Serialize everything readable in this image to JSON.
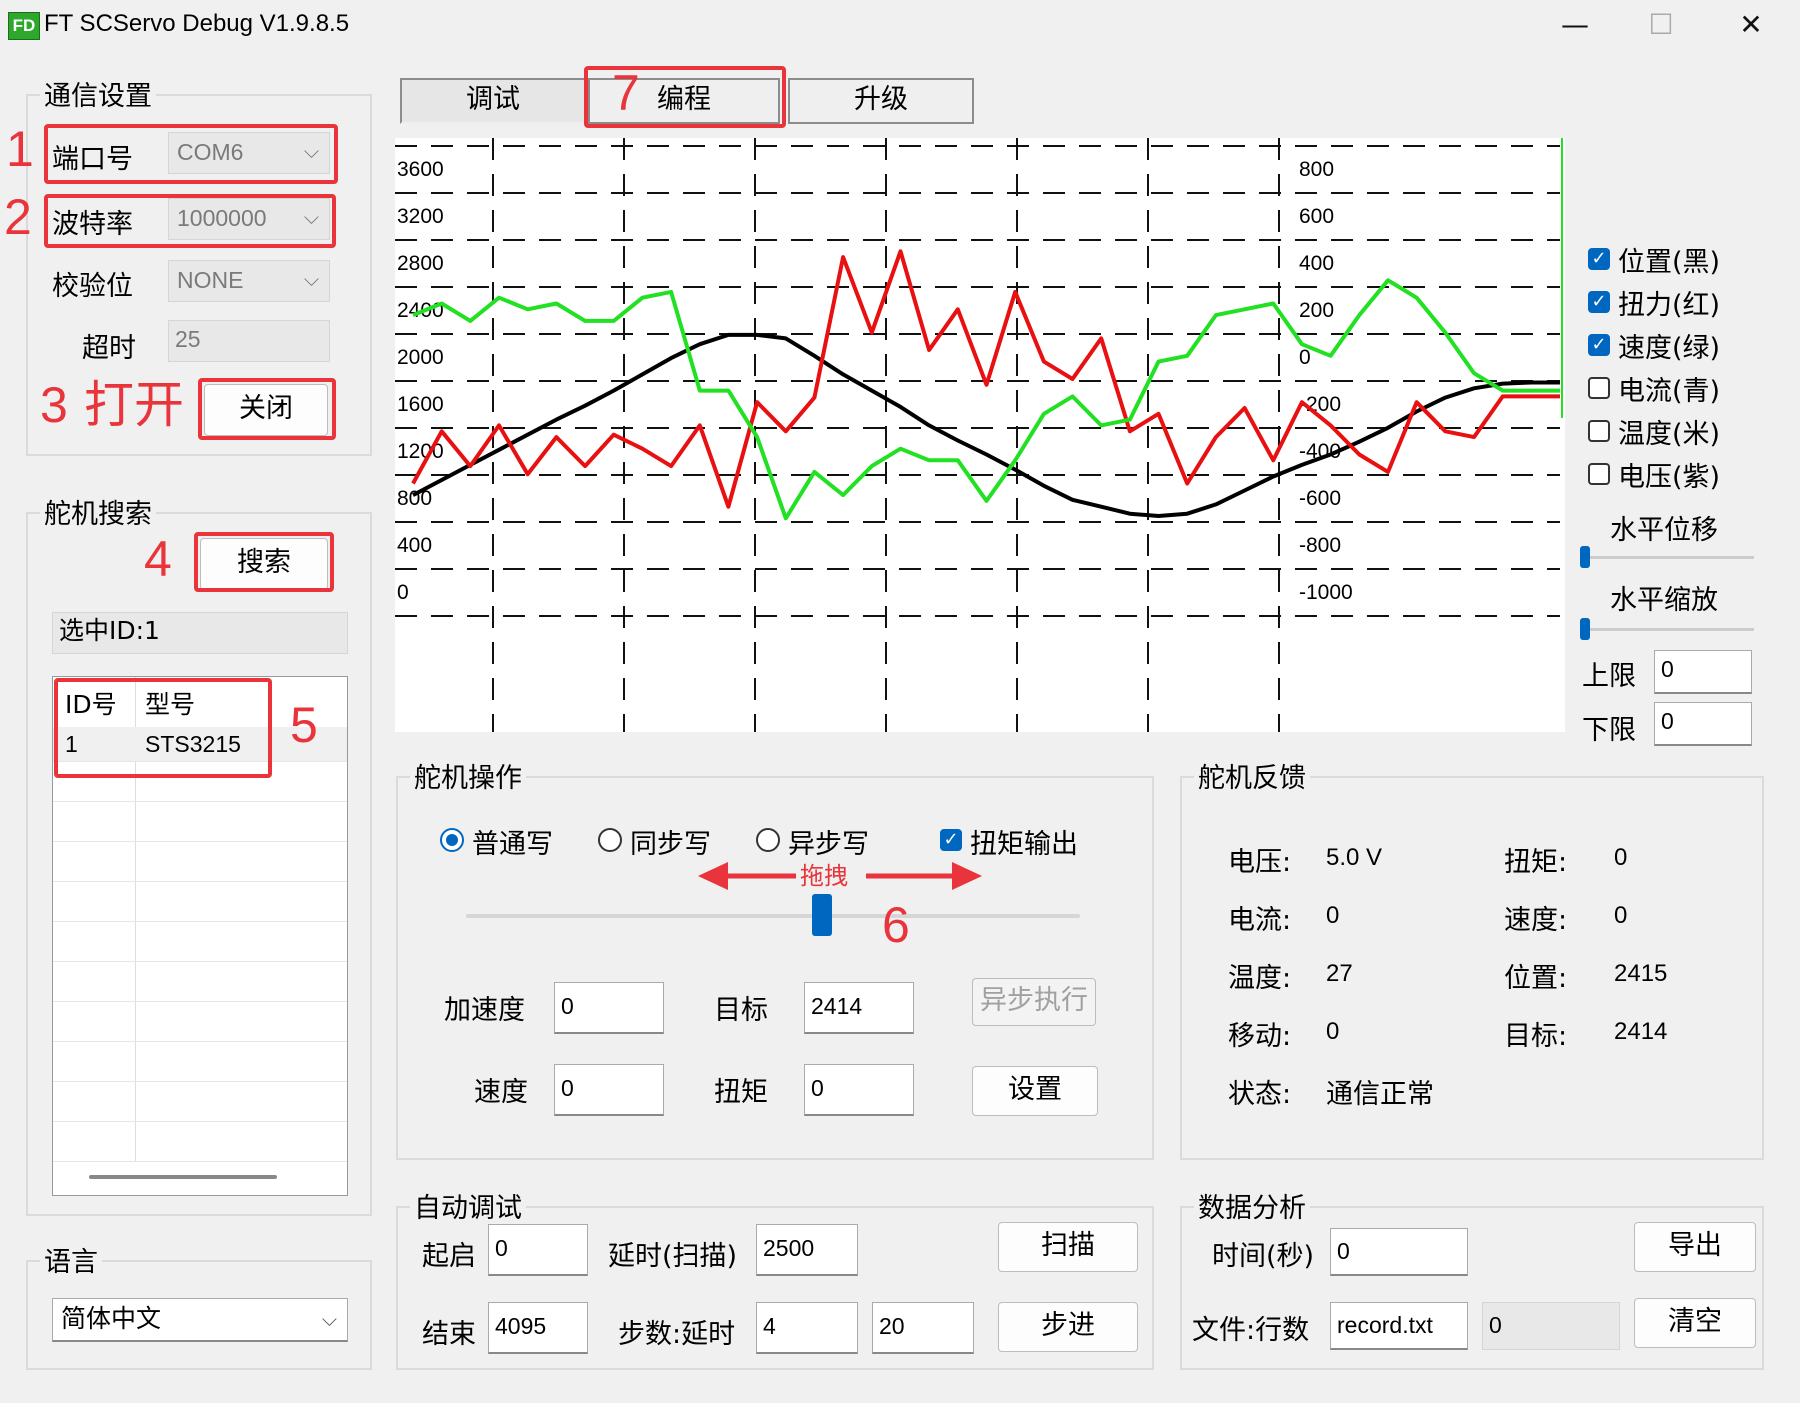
{
  "window": {
    "title": "FT SCServo Debug V1.9.8.5",
    "app_icon": "FD",
    "minimize": "—",
    "maximize": "☐",
    "close": "✕"
  },
  "annotations": {
    "n1": "1",
    "n2": "2",
    "n3": "3",
    "n3_text": "打开",
    "n4": "4",
    "n5": "5",
    "n6": "6",
    "n7": "7",
    "drag": "拖拽",
    "color": "#e8343a"
  },
  "comm": {
    "title": "通信设置",
    "port_label": "端口号",
    "port_value": "COM6",
    "baud_label": "波特率",
    "baud_value": "1000000",
    "parity_label": "校验位",
    "parity_value": "NONE",
    "timeout_label": "超时",
    "timeout_value": "25",
    "close_button": "关闭"
  },
  "search": {
    "title": "舵机搜索",
    "search_button": "搜索",
    "selected": "选中ID:1",
    "columns": [
      "ID号",
      "型号"
    ],
    "rows": [
      {
        "id": "1",
        "model": "STS3215"
      }
    ]
  },
  "language": {
    "title": "语言",
    "value": "简体中文"
  },
  "tabs": [
    {
      "label": "调试"
    },
    {
      "label": "编程"
    },
    {
      "label": "升级"
    }
  ],
  "chart_data": {
    "type": "line",
    "y_left_ticks": [
      "3600",
      "3200",
      "2800",
      "2400",
      "2000",
      "1600",
      "1200",
      "800",
      "400",
      "0"
    ],
    "y_right_ticks": [
      "800",
      "600",
      "400",
      "200",
      "0",
      "-200",
      "-400",
      "-600",
      "-800",
      "-1000"
    ],
    "ylim_left": [
      0,
      3600
    ],
    "ylim_right": [
      -1000,
      800
    ],
    "grid": true,
    "series": [
      {
        "name": "位置(黑)",
        "color": "#000000",
        "axis": "left",
        "values": [
          800,
          930,
          1060,
          1190,
          1320,
          1450,
          1570,
          1700,
          1840,
          1980,
          2100,
          2180,
          2180,
          2150,
          2000,
          1840,
          1700,
          1560,
          1400,
          1270,
          1150,
          1020,
          880,
          760,
          700,
          640,
          620,
          640,
          720,
          840,
          960,
          1060,
          1150,
          1260,
          1380,
          1520,
          1640,
          1720,
          1760,
          1770,
          1770
        ]
      },
      {
        "name": "扭力(红)",
        "color": "#e81010",
        "axis": "left",
        "values": [
          900,
          1350,
          1050,
          1400,
          980,
          1300,
          1050,
          1320,
          1200,
          1050,
          1400,
          700,
          1600,
          1350,
          1640,
          2850,
          2200,
          2900,
          2050,
          2400,
          1750,
          2550,
          1950,
          1800,
          2150,
          1350,
          1500,
          900,
          1300,
          1550,
          1100,
          1600,
          1400,
          1150,
          1000,
          1600,
          1350,
          1300,
          1650,
          1650,
          1650
        ]
      },
      {
        "name": "速度(绿)",
        "color": "#22e022",
        "axis": "left",
        "values": [
          2350,
          2450,
          2300,
          2500,
          2400,
          2450,
          2300,
          2300,
          2500,
          2550,
          1700,
          1700,
          1300,
          600,
          1000,
          800,
          1050,
          1200,
          1100,
          1100,
          750,
          1100,
          1500,
          1650,
          1400,
          1450,
          1950,
          2000,
          2350,
          2400,
          2450,
          2100,
          2000,
          2350,
          2650,
          2500,
          2200,
          1850,
          1700,
          1700,
          1700
        ]
      },
      {
        "name": "电流(青)",
        "color": "#00c0c0",
        "axis": "left",
        "values": []
      },
      {
        "name": "温度(米)",
        "color": "#d2c9a0",
        "axis": "left",
        "values": []
      },
      {
        "name": "电压(紫)",
        "color": "#9b30c0",
        "axis": "left",
        "values": []
      }
    ]
  },
  "legend": [
    {
      "label": "位置(黑)",
      "checked": true
    },
    {
      "label": "扭力(红)",
      "checked": true
    },
    {
      "label": "速度(绿)",
      "checked": true
    },
    {
      "label": "电流(青)",
      "checked": false
    },
    {
      "label": "温度(米)",
      "checked": false
    },
    {
      "label": "电压(紫)",
      "checked": false
    }
  ],
  "chart_controls": {
    "h_shift": "水平位移",
    "h_zoom": "水平缩放",
    "upper_label": "上限",
    "upper_value": "0",
    "lower_label": "下限",
    "lower_value": "0"
  },
  "operation": {
    "title": "舵机操作",
    "radio_normal": "普通写",
    "radio_sync": "同步写",
    "radio_async": "异步写",
    "torque_output": "扭矩输出",
    "slider_position": 0.58,
    "accel_label": "加速度",
    "accel_value": "0",
    "target_label": "目标",
    "target_value": "2414",
    "speed_label": "速度",
    "speed_value": "0",
    "torque_label": "扭矩",
    "torque_value": "0",
    "async_exec_button": "异步执行",
    "set_button": "设置"
  },
  "feedback": {
    "title": "舵机反馈",
    "voltage_label": "电压:",
    "voltage_value": "5.0 V",
    "torque_label": "扭矩:",
    "torque_value": "0",
    "current_label": "电流:",
    "current_value": "0",
    "speed_label": "速度:",
    "speed_value": "0",
    "temp_label": "温度:",
    "temp_value": "27",
    "position_label": "位置:",
    "position_value": "2415",
    "move_label": "移动:",
    "move_value": "0",
    "target_label": "目标:",
    "target_value": "2414",
    "status_label": "状态:",
    "status_value": "通信正常"
  },
  "auto": {
    "title": "自动调试",
    "start_label": "起启",
    "start_value": "0",
    "delay_label": "延时(扫描)",
    "delay_value": "2500",
    "scan_button": "扫描",
    "end_label": "结束",
    "end_value": "4095",
    "step_label": "步数:延时",
    "step_value": "4",
    "step_delay_value": "20",
    "step_button": "步进"
  },
  "analysis": {
    "title": "数据分析",
    "time_label": "时间(秒)",
    "time_value": "0",
    "export_button": "导出",
    "file_label": "文件:行数",
    "file_value": "record.txt",
    "rows_value": "0",
    "clear_button": "清空"
  }
}
